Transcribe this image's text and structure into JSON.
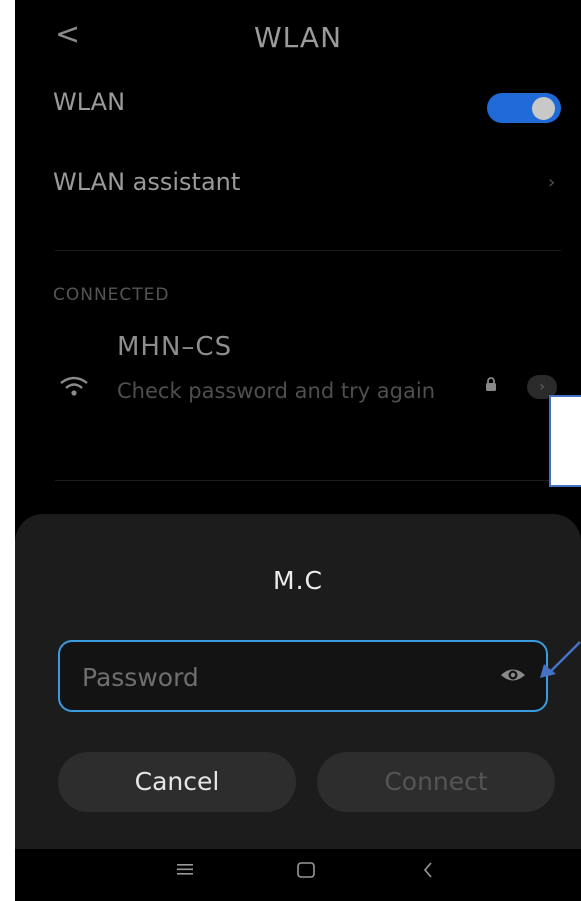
{
  "header": {
    "back_glyph": "<",
    "title": "WLAN"
  },
  "wlan_toggle": {
    "label": "WLAN",
    "state": "on",
    "color": "#1f6ad6"
  },
  "assistant": {
    "label": "WLAN assistant"
  },
  "connected": {
    "section_label": "CONNECTED",
    "network": {
      "name": "MHN–CS",
      "status": "Check password and try again",
      "secured": true
    }
  },
  "dialog": {
    "title": "M.C",
    "password": {
      "placeholder": "Password",
      "value": ""
    },
    "cancel_label": "Cancel",
    "connect_label": "Connect",
    "accent_color": "#3a9be0"
  },
  "nav": {
    "icons": [
      "menu-icon",
      "home-icon",
      "back-icon"
    ]
  }
}
